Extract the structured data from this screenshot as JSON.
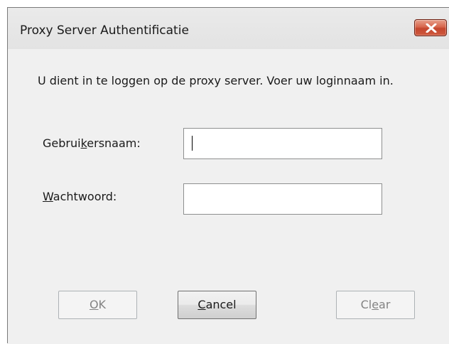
{
  "window": {
    "title": "Proxy Server Authentificatie",
    "close_symbol": "×"
  },
  "dialog": {
    "message": "U dient in te loggen op de proxy server. Voer uw loginnaam in.",
    "username": {
      "label_before": "Gebrui",
      "label_accel": "k",
      "label_after": "ersnaam:",
      "value": ""
    },
    "password": {
      "label_accel": "W",
      "label_after": "achtwoord:",
      "value": ""
    }
  },
  "buttons": {
    "ok": {
      "accel": "O",
      "rest": "K",
      "enabled": false
    },
    "cancel": {
      "accel": "C",
      "rest": "ancel",
      "enabled": true
    },
    "clear": {
      "before": "Cl",
      "accel": "e",
      "rest": "ar",
      "enabled": false
    }
  },
  "icons": {
    "close": "close-icon"
  },
  "colors": {
    "close_button": "#c4462e",
    "dialog_background": "#f0f0f0",
    "disabled_text": "#838383"
  }
}
